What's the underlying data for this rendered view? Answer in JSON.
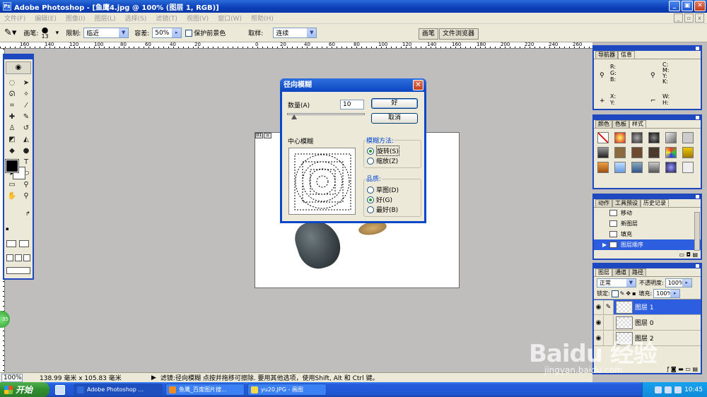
{
  "window": {
    "title": "Adobe Photoshop - [鱼鹰4.jpg @ 100% (图层 1, RGB)]",
    "app_icon": "Ps"
  },
  "menu": [
    "文件(F)",
    "编辑(E)",
    "图像(I)",
    "图层(L)",
    "选择(S)",
    "滤镜(T)",
    "视图(V)",
    "窗口(W)",
    "帮助(H)"
  ],
  "options": {
    "brush_label": "画笔:",
    "brush_size": "13",
    "limit_label": "限制:",
    "limit_value": "临近",
    "tolerance_label": "容差:",
    "tolerance_value": "50%",
    "protect_fg_label": "保护前景色",
    "sampling_label": "取样:",
    "sampling_value": "连续"
  },
  "palette_well": [
    "画笔",
    "文件浏览器"
  ],
  "ruler_numbers": [
    "160",
    "140",
    "120",
    "100",
    "80",
    "60",
    "40",
    "20",
    "0",
    "20",
    "40",
    "60",
    "80",
    "100",
    "120",
    "140",
    "160",
    "180",
    "200",
    "220",
    "240",
    "260",
    "280",
    "300"
  ],
  "document": {
    "tab_label": "01"
  },
  "dialog": {
    "title": "径向模糊",
    "amount_label": "数量(A)",
    "amount_value": "10",
    "ok_label": "好",
    "cancel_label": "取消",
    "center_label": "中心模糊",
    "method_label": "模糊方法:",
    "method_options": [
      "旋转(S)",
      "缩放(Z)"
    ],
    "method_selected": "旋转(S)",
    "quality_label": "品质:",
    "quality_options": [
      "草图(D)",
      "好(G)",
      "最好(B)"
    ],
    "quality_selected": "好(G)"
  },
  "navigator_panel": {
    "tabs": [
      "导航器",
      "信息"
    ],
    "rgb": "R:\nG:\nB:",
    "cmyk": "C:\nM:\nY:\nK:",
    "xy": "X:\nY:",
    "wh": "W:\nH:"
  },
  "swatch_panel": {
    "tabs": [
      "颜色",
      "色板",
      "样式"
    ]
  },
  "history_panel": {
    "tabs": [
      "动作",
      "工具预设",
      "历史记录"
    ],
    "items": [
      "移动",
      "新图层",
      "填充",
      "图层顺序"
    ],
    "selected": "图层顺序"
  },
  "layers_panel": {
    "tabs": [
      "图层",
      "通道",
      "路径"
    ],
    "blend_mode": "正常",
    "opacity_label": "不透明度:",
    "opacity_value": "100%",
    "lock_label": "锁定:",
    "fill_label": "填充:",
    "fill_value": "100%",
    "layers": [
      "图层 1",
      "图层 0",
      "图层 2"
    ],
    "selected": "图层 1"
  },
  "status": {
    "zoom": "100%",
    "doc_size": "138.99 毫米 x 105.83 毫米",
    "hint": "滤镜:径向模糊  点按并拖移可擦除. 要用其他选项，使用Shift, Alt 和 Ctrl 键。"
  },
  "taskbar": {
    "start_label": "开始",
    "tasks": [
      "Adobe Photoshop ...",
      "鱼鹰_百度图片搜...",
      "yu20.JPG - 画图"
    ],
    "clock": "10:45"
  },
  "green_badge": "35",
  "watermark": {
    "text": "Baidu 经验",
    "url": "jingyan.baidu.com"
  },
  "colors": {
    "accent": "#1e48c0",
    "workspace": "#c0bebd",
    "selection": "#2e5ee0"
  }
}
